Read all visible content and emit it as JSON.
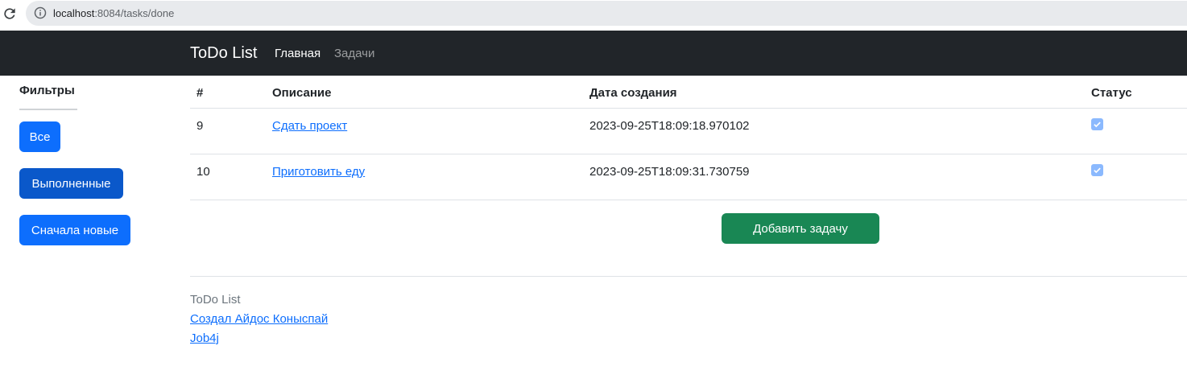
{
  "browser": {
    "url_host": "localhost",
    "url_rest": ":8084/tasks/done"
  },
  "navbar": {
    "brand": "ToDo List",
    "links": [
      "Главная",
      "Задачи"
    ]
  },
  "sidebar": {
    "title": "Фильтры",
    "buttons": [
      "Все",
      "Выполненные",
      "Сначала новые"
    ],
    "active_button": "Выполненные"
  },
  "table": {
    "headers": [
      "#",
      "Описание",
      "Дата создания",
      "Статус"
    ],
    "rows": [
      {
        "id": "9",
        "description": "Сдать проект",
        "created": "2023-09-25T18:09:18.970102",
        "done": true
      },
      {
        "id": "10",
        "description": "Приготовить еду",
        "created": "2023-09-25T18:09:31.730759",
        "done": true
      }
    ]
  },
  "add_button": "Добавить задачу",
  "footer": {
    "brand": "ToDo List",
    "author_link": "Создал Айдос Коныспай",
    "school_link": "Job4j"
  },
  "colors": {
    "navbar_bg": "#212529",
    "primary": "#0d6efd",
    "primary_active": "#0a58ca",
    "success": "#198754",
    "checkbox_disabled": "#8bb9fe"
  },
  "icons": {
    "reload": "reload-icon",
    "info": "info-icon",
    "check": "checkmark-icon"
  }
}
